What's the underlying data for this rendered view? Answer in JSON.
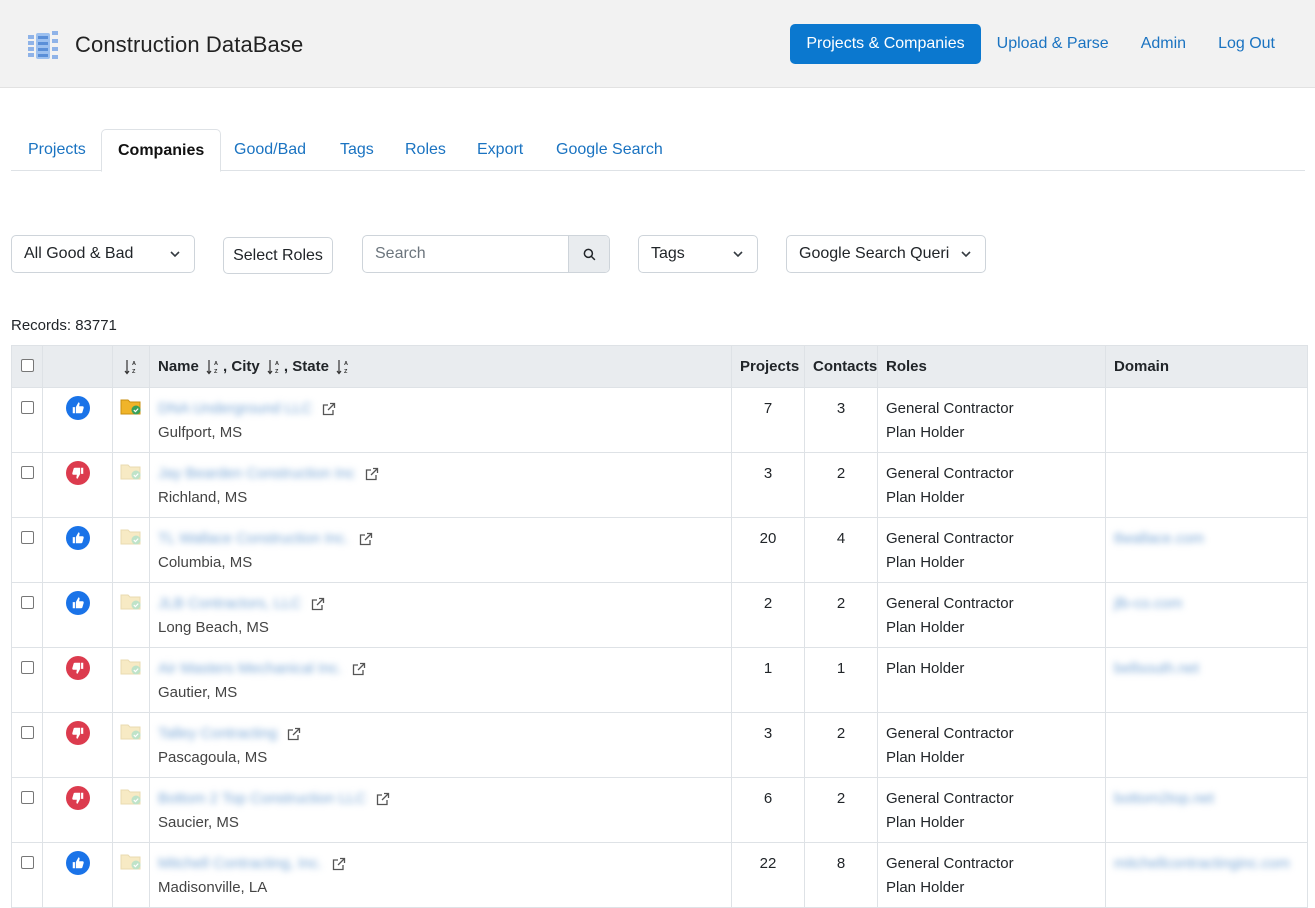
{
  "app": {
    "title": "Construction DataBase"
  },
  "nav": {
    "items": [
      {
        "label": "Projects & Companies",
        "active": true
      },
      {
        "label": "Upload & Parse",
        "active": false
      },
      {
        "label": "Admin",
        "active": false
      },
      {
        "label": "Log Out",
        "active": false
      }
    ]
  },
  "tabs": [
    {
      "label": "Projects",
      "active": false
    },
    {
      "label": "Companies",
      "active": true
    },
    {
      "label": "Good/Bad",
      "active": false
    },
    {
      "label": "Tags",
      "active": false
    },
    {
      "label": "Roles",
      "active": false
    },
    {
      "label": "Export",
      "active": false
    },
    {
      "label": "Google Search",
      "active": false
    }
  ],
  "filters": {
    "good_bad": "All Good & Bad",
    "roles": "Select Roles",
    "search_placeholder": "Search",
    "tags": "Tags",
    "google_search": "Google Search Queries"
  },
  "records_label": "Records: 83771",
  "table": {
    "headers": {
      "name": "Name",
      "city": "City",
      "state": "State",
      "projects": "Projects",
      "contacts": "Contacts",
      "roles": "Roles",
      "domain": "Domain"
    },
    "rows": [
      {
        "rating": "good",
        "folder": "active",
        "name": "DNA Underground LLC",
        "location": "Gulfport, MS",
        "projects": "7",
        "contacts": "3",
        "roles": [
          "General Contractor",
          "Plan Holder"
        ],
        "domain": ""
      },
      {
        "rating": "bad",
        "folder": "faded",
        "name": "Jay Bearden Construction Inc",
        "location": "Richland, MS",
        "projects": "3",
        "contacts": "2",
        "roles": [
          "General Contractor",
          "Plan Holder"
        ],
        "domain": ""
      },
      {
        "rating": "good",
        "folder": "faded",
        "name": "TL Wallace Construction Inc.",
        "location": "Columbia, MS",
        "projects": "20",
        "contacts": "4",
        "roles": [
          "General Contractor",
          "Plan Holder"
        ],
        "domain": "tlwallace.com"
      },
      {
        "rating": "good",
        "folder": "faded",
        "name": "JLB Contractors, LLC",
        "location": "Long Beach, MS",
        "projects": "2",
        "contacts": "2",
        "roles": [
          "General Contractor",
          "Plan Holder"
        ],
        "domain": "jlb-co.com"
      },
      {
        "rating": "bad",
        "folder": "faded",
        "name": "Air Masters Mechanical Inc.",
        "location": "Gautier, MS",
        "projects": "1",
        "contacts": "1",
        "roles": [
          "Plan Holder"
        ],
        "domain": "bellsouth.net"
      },
      {
        "rating": "bad",
        "folder": "faded",
        "name": "Talley Contracting",
        "location": "Pascagoula, MS",
        "projects": "3",
        "contacts": "2",
        "roles": [
          "General Contractor",
          "Plan Holder"
        ],
        "domain": ""
      },
      {
        "rating": "bad",
        "folder": "faded",
        "name": "Bottom 2 Top Construction LLC",
        "location": "Saucier, MS",
        "projects": "6",
        "contacts": "2",
        "roles": [
          "General Contractor",
          "Plan Holder"
        ],
        "domain": "bottom2top.net"
      },
      {
        "rating": "good",
        "folder": "faded",
        "name": "Mitchell Contracting, Inc.",
        "location": "Madisonville, LA",
        "projects": "22",
        "contacts": "8",
        "roles": [
          "General Contractor",
          "Plan Holder"
        ],
        "domain": "mitchellcontractinginc.com"
      }
    ]
  },
  "colors": {
    "primary": "#0b78cf",
    "link": "#1a73c1",
    "good": "#1a73e8",
    "bad": "#dc3b4e",
    "folder_active": "#f0b429",
    "folder_faded": "#f7eac4"
  }
}
